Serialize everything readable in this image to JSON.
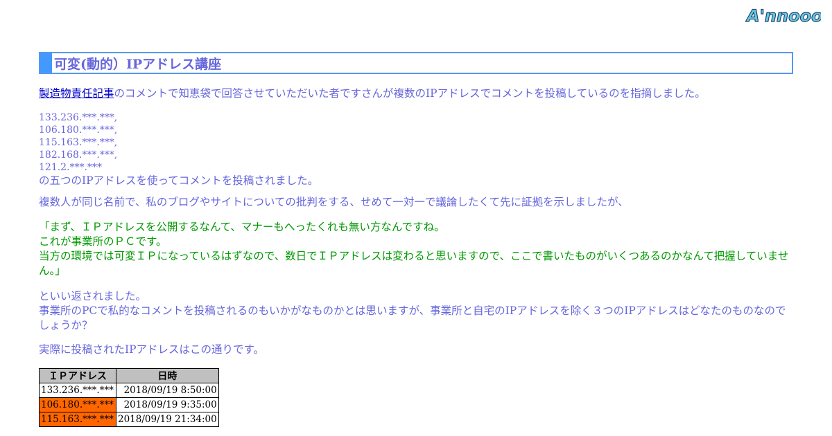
{
  "logo": {
    "text": "A'nnooors"
  },
  "title": "可変(動的）IPアドレス講座",
  "intro": {
    "link_text": "製造物責任記事",
    "rest": "のコメントで知恵袋で回答させていただいた者ですさんが複数のIPアドレスでコメントを投稿しているのを指摘しました。"
  },
  "ip_list": [
    "133.236.***.***,",
    "106.180.***.***,",
    "115.163.***.***,",
    "182.168.***.***,",
    "121.2.***.***"
  ],
  "ip_list_tail": "の五つのIPアドレスを使ってコメントを投稿されました。",
  "para2": "複数人が同じ名前で、私のブログやサイトについての批判をする、せめて一対一で議論したくて先に証拠を示しましたが、",
  "quote": {
    "line1": "「まず、ＩＰアドレスを公開するなんて、マナーもへったくれも無い方なんですね。",
    "line2": "これが事業所のＰＣです。",
    "line3": "当方の環境では可変ＩＰになっているはずなので、数日でＩＰアドレスは変わると思いますので、ここで書いたものがいくつあるのかなんて把握していません。」"
  },
  "para4": {
    "line1": "といい返されました。",
    "line2": "事業所のPCで私的なコメントを投稿されるのもいかがなものかとは思いますが、事業所と自宅のIPアドレスを除く３つのIPアドレスはどなたのものなのでしょうか？"
  },
  "para5": "実際に投稿されたIPアドレスはこの通りです。",
  "table": {
    "headers": [
      "ＩＰアドレス",
      "日時"
    ],
    "rows": [
      {
        "ip": "133.236.***.***",
        "datetime": "2018/09/19 8:50:00",
        "highlight": false
      },
      {
        "ip": "106.180.***.***",
        "datetime": "2018/09/19 9:35:00",
        "highlight": true
      },
      {
        "ip": "115.163.***.***",
        "datetime": "2018/09/19 21:34:00",
        "highlight": true
      }
    ],
    "highlight_color": "#ff6600"
  }
}
